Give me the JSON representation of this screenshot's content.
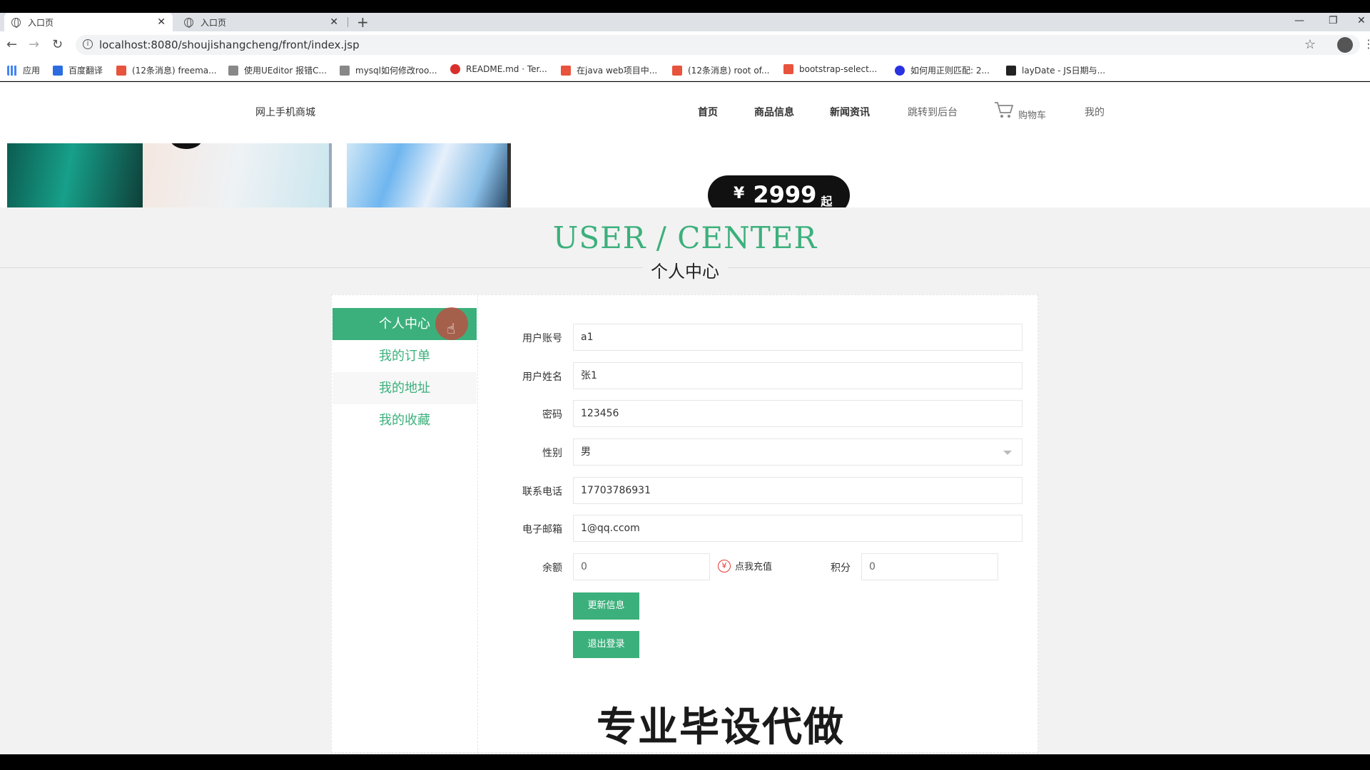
{
  "browser": {
    "tabs": [
      {
        "title": "入口页"
      },
      {
        "title": "入口页"
      }
    ],
    "url": "localhost:8080/shoujishangcheng/front/index.jsp",
    "bookmarks": [
      {
        "label": "应用",
        "color": "#4285f4"
      },
      {
        "label": "百度翻译",
        "color": "#2b6de0"
      },
      {
        "label": "(12条消息) freema...",
        "color": "#e8533d"
      },
      {
        "label": "使用UEditor 报错C...",
        "color": "#555555"
      },
      {
        "label": "mysql如何修改roo...",
        "color": "#555555"
      },
      {
        "label": "README.md · Ter...",
        "color": "#d9302c"
      },
      {
        "label": "在java web项目中...",
        "color": "#e8533d"
      },
      {
        "label": "(12条消息) root of...",
        "color": "#e8533d"
      },
      {
        "label": "bootstrap-select...",
        "color": "#e8533d"
      },
      {
        "label": "如何用正则匹配: 2...",
        "color": "#2932e1"
      },
      {
        "label": "layDate - JS日期与...",
        "color": "#222222"
      }
    ]
  },
  "site": {
    "logo": "网上手机商城",
    "nav": {
      "home": "首页",
      "products": "商品信息",
      "news": "新闻资讯",
      "admin": "跳转到后台",
      "cart": "购物车",
      "mine": "我的"
    }
  },
  "banner": {
    "currency": "¥",
    "price": "2999",
    "suffix": "起"
  },
  "heading": {
    "en": "USER / CENTER",
    "cn": "个人中心"
  },
  "sidebar": {
    "items": [
      {
        "label": "个人中心"
      },
      {
        "label": "我的订单"
      },
      {
        "label": "我的地址"
      },
      {
        "label": "我的收藏"
      }
    ]
  },
  "form": {
    "username": {
      "label": "用户账号",
      "value": "a1"
    },
    "realname": {
      "label": "用户姓名",
      "value": "张1"
    },
    "password": {
      "label": "密码",
      "value": "123456"
    },
    "gender": {
      "label": "性别",
      "value": "男"
    },
    "phone": {
      "label": "联系电话",
      "value": "17703786931"
    },
    "email": {
      "label": "电子邮箱",
      "value": "1@qq.ccom"
    },
    "balance": {
      "label": "余额",
      "value": "0"
    },
    "recharge": "点我充值",
    "recharge_icon": "¥",
    "points": {
      "label": "积分",
      "value": "0"
    },
    "update_button": "更新信息",
    "logout_button": "退出登录"
  },
  "overlay": {
    "watermark": "专业毕设代做"
  },
  "colors": {
    "accent": "#3cb07c",
    "recharge_icon": "#e53935"
  }
}
